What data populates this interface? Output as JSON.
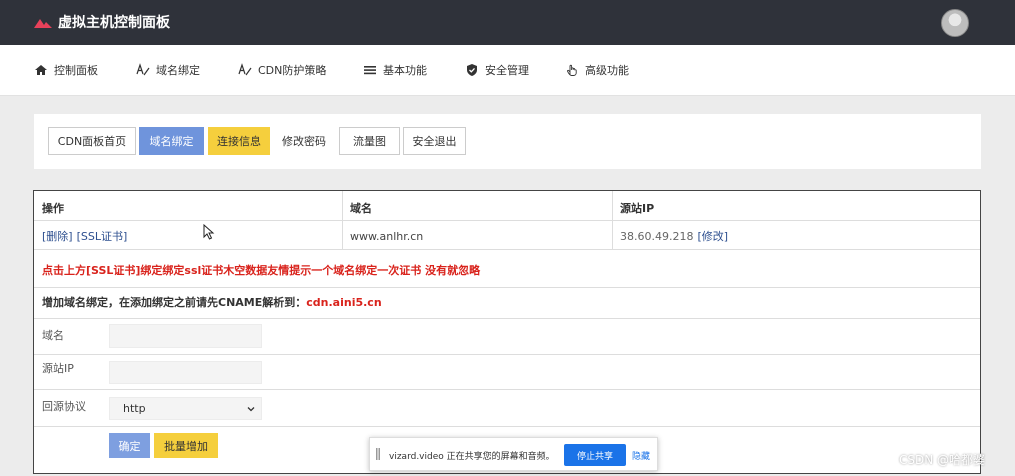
{
  "header": {
    "title": "虚拟主机控制面板"
  },
  "nav": [
    {
      "label": "控制面板",
      "icon": "home-icon"
    },
    {
      "label": "域名绑定",
      "icon": "text-a-icon"
    },
    {
      "label": "CDN防护策略",
      "icon": "text-a-icon"
    },
    {
      "label": "基本功能",
      "icon": "list-icon"
    },
    {
      "label": "安全管理",
      "icon": "shield-icon"
    },
    {
      "label": "高级功能",
      "icon": "hand-pointer-icon"
    }
  ],
  "toolbar": {
    "buttons": [
      {
        "label": "CDN面板首页",
        "state": "default"
      },
      {
        "label": "域名绑定",
        "state": "active"
      },
      {
        "label": "连接信息",
        "state": "warning"
      },
      {
        "label": "修改密码",
        "state": "plain"
      },
      {
        "label": "流量图",
        "state": "default"
      },
      {
        "label": "安全退出",
        "state": "default"
      }
    ]
  },
  "table": {
    "headers": {
      "action": "操作",
      "domain": "域名",
      "source_ip": "源站IP"
    },
    "rows": [
      {
        "delete": "[删除]",
        "ssl": "[SSL证书]",
        "domain": "www.anlhr.cn",
        "ip": "38.60.49.218",
        "modify": "[修改]"
      }
    ],
    "notice_part1": "点击上方[SSL证书]绑定绑定ssl证书",
    "notice_part2": "木空数据友情提示一个域名绑定一次证书 没有就忽略",
    "cname_text": "增加域名绑定，在添加绑定之前请先CNAME解析到：",
    "cname_target": "cdn.aini5.cn"
  },
  "form": {
    "domain_label": "域名",
    "domain_value": "",
    "ip_label": "源站IP",
    "ip_value": "",
    "protocol_label": "回源协议",
    "protocol_value": "http",
    "confirm_label": "确定",
    "batch_label": "批量增加"
  },
  "share_bar": {
    "text": "vizard.video 正在共享您的屏幕和音频。",
    "stop_label": "停止共享",
    "hide_label": "隐藏"
  },
  "watermark": "CSDN @哈都婆",
  "colors": {
    "topbar": "#2f323a",
    "brand_icon": "#e8415a",
    "active_button": "#6f94dc",
    "warning_button": "#f5cf3d",
    "notice_red": "#d9231c",
    "share_blue": "#1a73e8"
  }
}
